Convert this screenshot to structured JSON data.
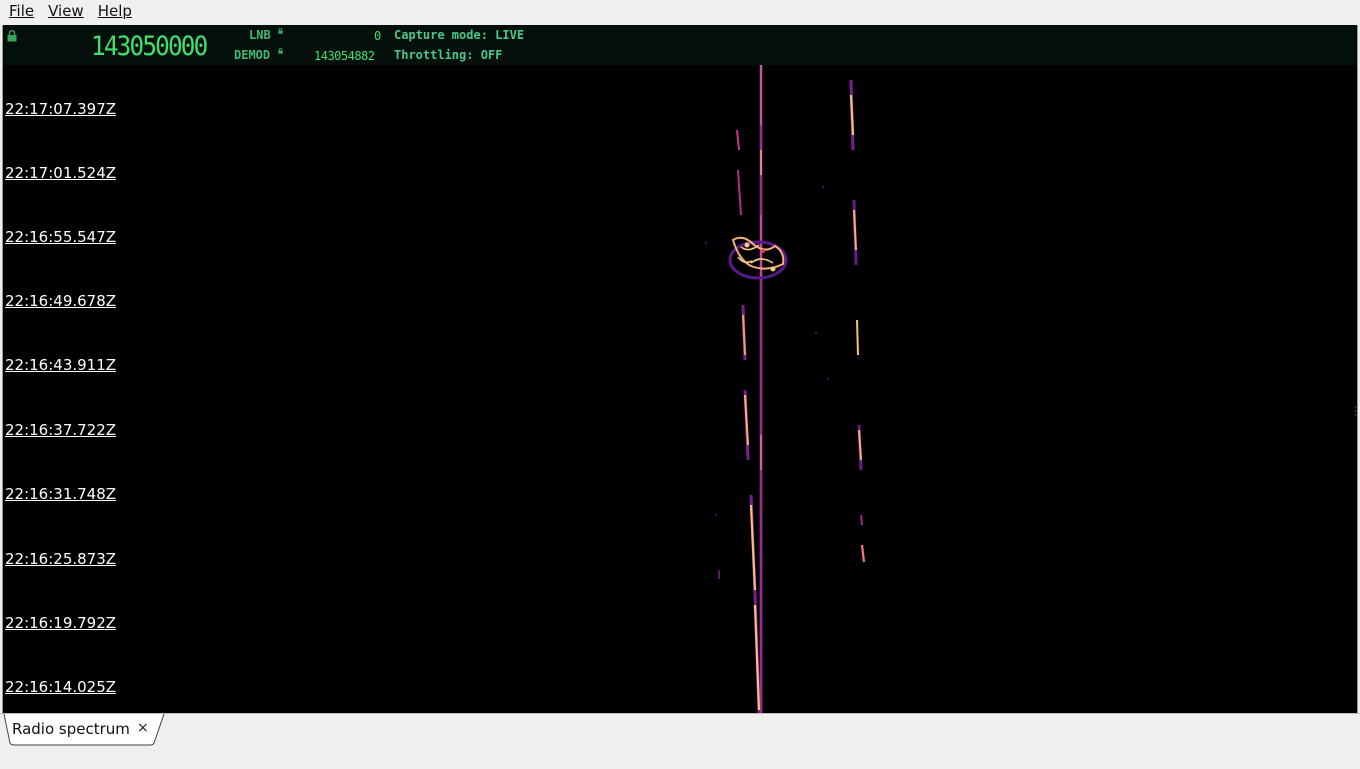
{
  "menu": {
    "items": [
      {
        "label": "File"
      },
      {
        "label": "View"
      },
      {
        "label": "Help"
      }
    ]
  },
  "header": {
    "main_frequency": "143050000",
    "lnb_label": "LNB",
    "lnb_value": "0",
    "demod_label": "DEMOD",
    "demod_value": "143054882",
    "capture_mode": "Capture mode: LIVE",
    "throttling": "Throttling: OFF"
  },
  "waterfall": {
    "timestamps": [
      "22:17:07.397Z",
      "22:17:01.524Z",
      "22:16:55.547Z",
      "22:16:49.678Z",
      "22:16:43.911Z",
      "22:16:37.722Z",
      "22:16:31.748Z",
      "22:16:25.873Z",
      "22:16:19.792Z",
      "22:16:14.025Z"
    ]
  },
  "tabs": [
    {
      "label": "Radio spectrum",
      "close": "×"
    }
  ],
  "colors": {
    "display_green": "#3ee070",
    "label_green": "#3dbb75",
    "signal_hot": "#f9c07a",
    "signal_mid": "#e0337a",
    "signal_low": "#5a1a8c"
  }
}
